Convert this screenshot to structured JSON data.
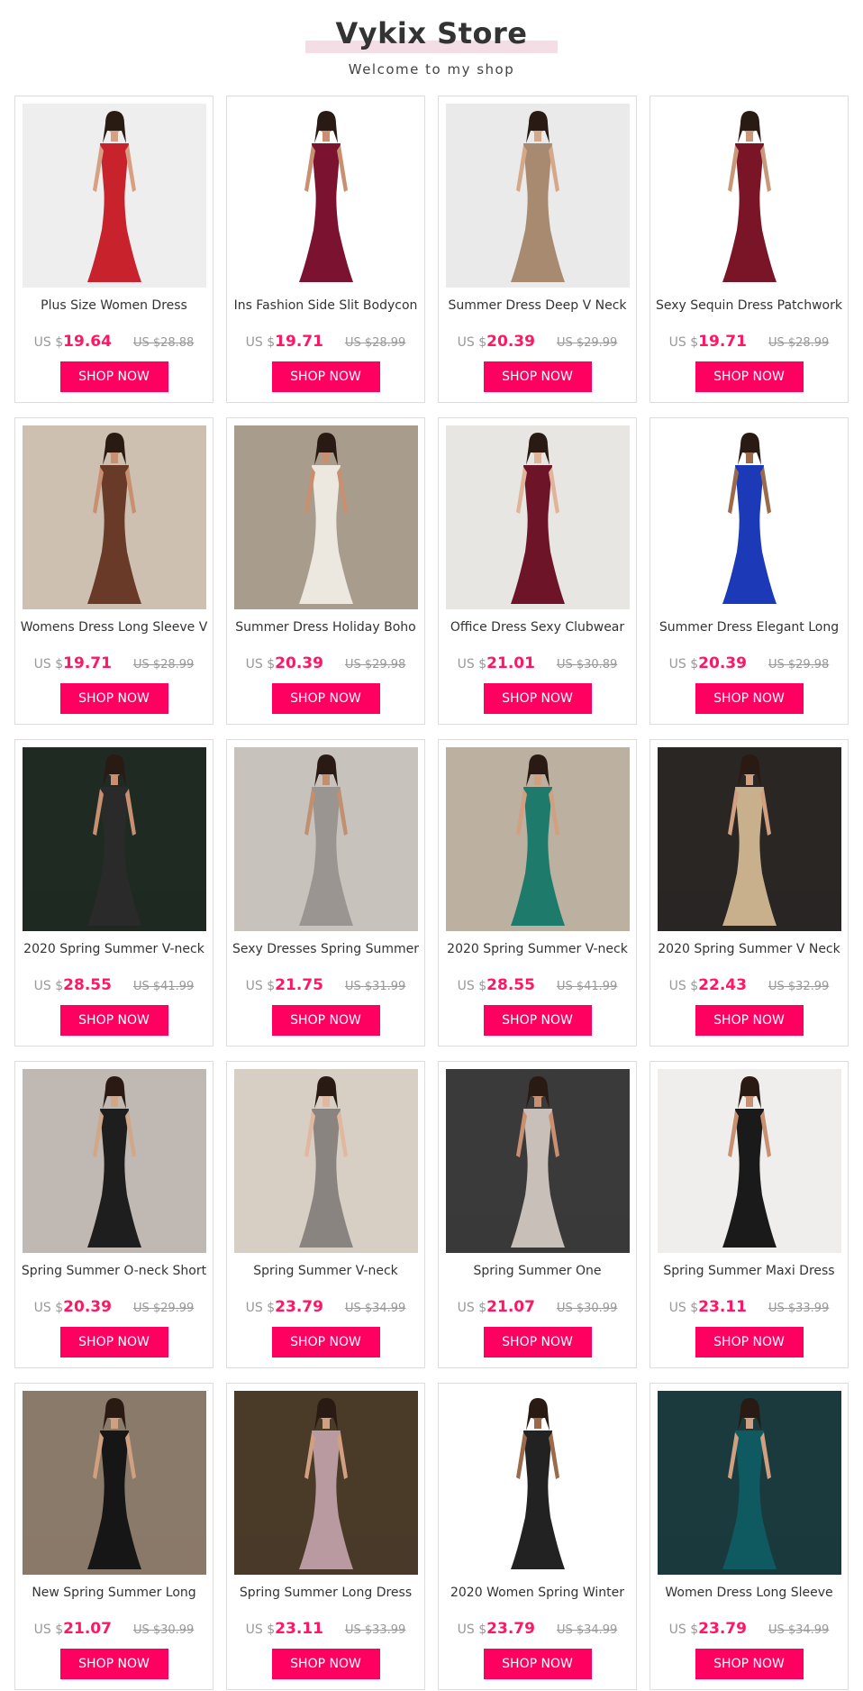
{
  "store": {
    "title": "Vykix Store",
    "subtitle": "Welcome to my shop"
  },
  "colors": {
    "accent": "#ff0060",
    "price": "#ff1763",
    "title_band": "#f4dde5"
  },
  "products": [
    {
      "title": "Plus Size Women Dress",
      "currency": "US $",
      "price": "19.64",
      "old_price": "US $28.88",
      "button": "SHOP NOW",
      "photo": {
        "bg": "#eeeeee",
        "dress": "#c8222c",
        "skin": "#d8a083"
      }
    },
    {
      "title": "Ins Fashion Side Slit Bodycon",
      "currency": "US $",
      "price": "19.71",
      "old_price": "US $28.99",
      "button": "SHOP NOW",
      "photo": {
        "bg": "#ffffff",
        "dress": "#7a1230",
        "skin": "#c89070"
      }
    },
    {
      "title": "Summer Dress Deep V Neck",
      "currency": "US $",
      "price": "20.39",
      "old_price": "US $29.99",
      "button": "SHOP NOW",
      "photo": {
        "bg": "#eaeaea",
        "dress": "#a88a70",
        "skin": "#d4a888"
      }
    },
    {
      "title": "Sexy Sequin Dress Patchwork",
      "currency": "US $",
      "price": "19.71",
      "old_price": "US $28.99",
      "button": "SHOP NOW",
      "photo": {
        "bg": "#ffffff",
        "dress": "#7a1528",
        "skin": "#c89878"
      }
    },
    {
      "title": "Womens Dress Long Sleeve V",
      "currency": "US $",
      "price": "19.71",
      "old_price": "US $28.99",
      "button": "SHOP NOW",
      "photo": {
        "bg": "#cdc0b0",
        "dress": "#6a3a28",
        "skin": "#c89070"
      }
    },
    {
      "title": "Summer Dress Holiday Boho",
      "currency": "US $",
      "price": "20.39",
      "old_price": "US $29.98",
      "button": "SHOP NOW",
      "photo": {
        "bg": "#a89c8c",
        "dress": "#ece8e0",
        "skin": "#c89070"
      }
    },
    {
      "title": "Office Dress Sexy Clubwear",
      "currency": "US $",
      "price": "21.01",
      "old_price": "US $30.89",
      "button": "SHOP NOW",
      "photo": {
        "bg": "#e8e6e2",
        "dress": "#6e1428",
        "skin": "#e0b498"
      }
    },
    {
      "title": "Summer Dress Elegant Long",
      "currency": "US $",
      "price": "20.39",
      "old_price": "US $29.98",
      "button": "SHOP NOW",
      "photo": {
        "bg": "#ffffff",
        "dress": "#1c3ab8",
        "skin": "#9a6a4a"
      }
    },
    {
      "title": "2020 Spring Summer V-neck",
      "currency": "US $",
      "price": "28.55",
      "old_price": "US $41.99",
      "button": "SHOP NOW",
      "photo": {
        "bg": "#1e2a22",
        "dress": "#2a2a2a",
        "skin": "#c89070"
      }
    },
    {
      "title": "Sexy Dresses Spring Summer",
      "currency": "US $",
      "price": "21.75",
      "old_price": "US $31.99",
      "button": "SHOP NOW",
      "photo": {
        "bg": "#c8c2bc",
        "dress": "#9a9590",
        "skin": "#c09070"
      }
    },
    {
      "title": "2020 Spring Summer V-neck",
      "currency": "US $",
      "price": "28.55",
      "old_price": "US $41.99",
      "button": "SHOP NOW",
      "photo": {
        "bg": "#bcb0a0",
        "dress": "#1e7a6a",
        "skin": "#d0a080"
      }
    },
    {
      "title": "2020 Spring Summer V Neck",
      "currency": "US $",
      "price": "22.43",
      "old_price": "US $32.99",
      "button": "SHOP NOW",
      "photo": {
        "bg": "#2a2624",
        "dress": "#c8b08c",
        "skin": "#d0a080"
      }
    },
    {
      "title": "Spring Summer O-neck Short",
      "currency": "US $",
      "price": "20.39",
      "old_price": "US $29.99",
      "button": "SHOP NOW",
      "photo": {
        "bg": "#bfb8b3",
        "dress": "#1e1e1e",
        "skin": "#d0a888"
      }
    },
    {
      "title": "Spring Summer V-neck",
      "currency": "US $",
      "price": "23.79",
      "old_price": "US $34.99",
      "button": "SHOP NOW",
      "photo": {
        "bg": "#d8cfc4",
        "dress": "#8a8480",
        "skin": "#e0b8a0"
      }
    },
    {
      "title": "Spring Summer One",
      "currency": "US $",
      "price": "21.07",
      "old_price": "US $30.99",
      "button": "SHOP NOW",
      "photo": {
        "bg": "#3a3a3a",
        "dress": "#c8c0b8",
        "skin": "#c89070"
      }
    },
    {
      "title": "Spring Summer Maxi Dress",
      "currency": "US $",
      "price": "23.11",
      "old_price": "US $33.99",
      "button": "SHOP NOW",
      "photo": {
        "bg": "#f0eeec",
        "dress": "#1a1a1a",
        "skin": "#c89070"
      }
    },
    {
      "title": "New Spring Summer Long",
      "currency": "US $",
      "price": "21.07",
      "old_price": "US $30.99",
      "button": "SHOP NOW",
      "photo": {
        "bg": "#8a7a6a",
        "dress": "#161616",
        "skin": "#d0a080"
      }
    },
    {
      "title": "Spring Summer Long Dress",
      "currency": "US $",
      "price": "23.11",
      "old_price": "US $33.99",
      "button": "SHOP NOW",
      "photo": {
        "bg": "#4a3a28",
        "dress": "#b89aa0",
        "skin": "#d0a080"
      }
    },
    {
      "title": "2020 Women Spring Winter",
      "currency": "US $",
      "price": "23.79",
      "old_price": "US $34.99",
      "button": "SHOP NOW",
      "photo": {
        "bg": "#ffffff",
        "dress": "#222222",
        "skin": "#9a6a4a"
      }
    },
    {
      "title": "Women Dress Long Sleeve",
      "currency": "US $",
      "price": "23.79",
      "old_price": "US $34.99",
      "button": "SHOP NOW",
      "photo": {
        "bg": "#1a3a3e",
        "dress": "#0e5a60",
        "skin": "#d0a080"
      }
    }
  ]
}
